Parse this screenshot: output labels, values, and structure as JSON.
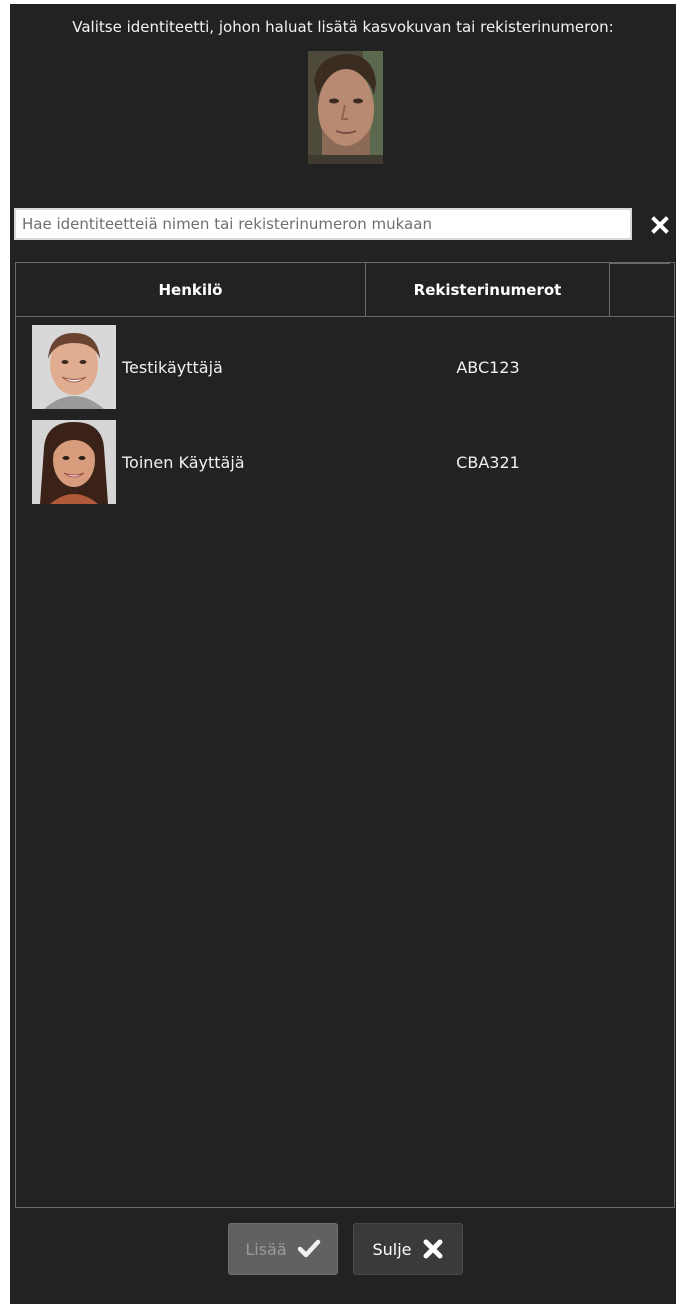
{
  "prompt_text": "Valitse identiteetti, johon haluat lisätä kasvokuvan tai rekisterinumeron:",
  "search": {
    "placeholder": "Hae identiteetteiä nimen tai rekisterinumeron mukaan",
    "value": ""
  },
  "table": {
    "columns": [
      "Henkilö",
      "Rekisterinumerot",
      ""
    ],
    "rows": [
      {
        "name": "Testikäyttäjä",
        "plates": "ABC123"
      },
      {
        "name": "Toinen Käyttäjä",
        "plates": "CBA321"
      }
    ]
  },
  "buttons": {
    "add_label": "Lisää",
    "close_label": "Sulje"
  },
  "colors": {
    "background": "#222222",
    "border": "#6a6a6a",
    "button_disabled": "#616161",
    "button": "#3a3a3a"
  },
  "icons": {
    "clear": "close-icon",
    "add": "check-icon",
    "close": "close-icon"
  }
}
